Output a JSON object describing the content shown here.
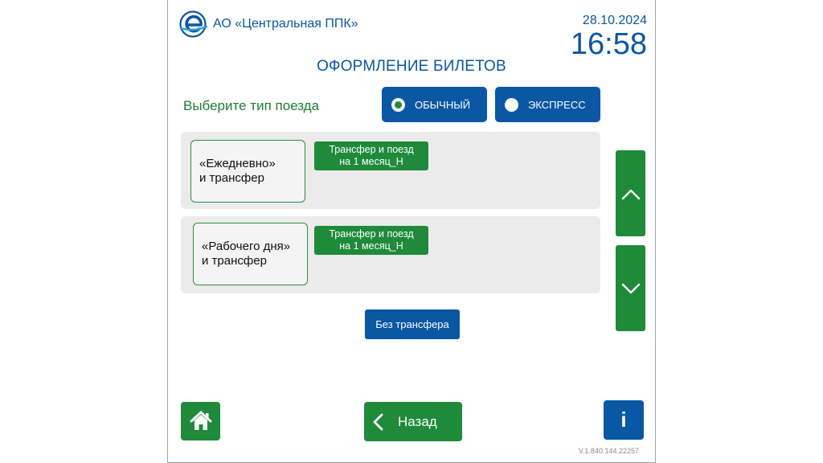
{
  "header": {
    "brand": "АО «Центральная ППК»",
    "date": "28.10.2024",
    "time": "16:58"
  },
  "page_title": "ОФОРМЛЕНИЕ БИЛЕТОВ",
  "train_type": {
    "label": "Выберите тип поезда",
    "options": [
      {
        "label": "ОБЫЧНЫЙ",
        "selected": true
      },
      {
        "label": "ЭКСПРЕСС",
        "selected": false
      }
    ]
  },
  "tickets": [
    {
      "name_line1": "«Ежедневно»",
      "name_line2": "и трансфер",
      "option_line1": "Трансфер и поезд",
      "option_line2": "на 1 месяц_Н"
    },
    {
      "name_line1": "«Рабочего дня»",
      "name_line2": "и  трансфер",
      "option_line1": "Трансфер и поезд",
      "option_line2": "на 1 месяц_Н"
    }
  ],
  "no_transfer_label": "Без трансфера",
  "footer": {
    "back_label": "Назад",
    "info_label": "i",
    "version": "V.1.840.144.22257"
  },
  "colors": {
    "brand_blue": "#0a57a4",
    "brand_green": "#1e8a3a",
    "panel_gray": "#ebebeb"
  },
  "icons": {
    "logo": "logo-icon",
    "scroll_up": "chevron-up-icon",
    "scroll_down": "chevron-down-icon",
    "home": "home-icon",
    "back": "chevron-left-icon"
  }
}
